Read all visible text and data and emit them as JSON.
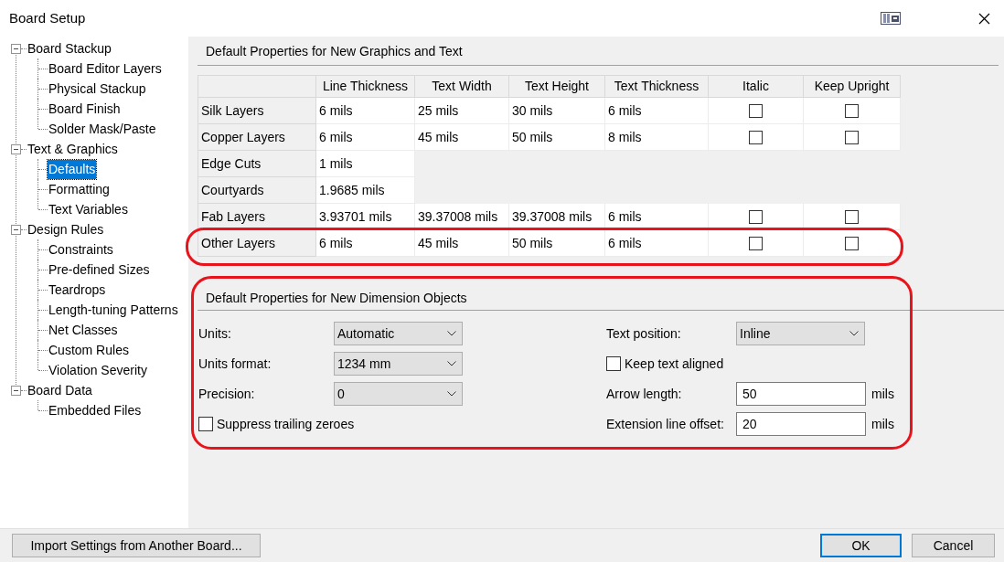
{
  "window": {
    "title": "Board Setup"
  },
  "tree": [
    {
      "label": "Board Stackup",
      "expanded": true,
      "selected": false,
      "children": [
        {
          "label": "Board Editor Layers",
          "selected": false
        },
        {
          "label": "Physical Stackup",
          "selected": false
        },
        {
          "label": "Board Finish",
          "selected": false
        },
        {
          "label": "Solder Mask/Paste",
          "selected": false
        }
      ]
    },
    {
      "label": "Text & Graphics",
      "expanded": true,
      "selected": false,
      "children": [
        {
          "label": "Defaults",
          "selected": true
        },
        {
          "label": "Formatting",
          "selected": false
        },
        {
          "label": "Text Variables",
          "selected": false
        }
      ]
    },
    {
      "label": "Design Rules",
      "expanded": true,
      "selected": false,
      "children": [
        {
          "label": "Constraints",
          "selected": false
        },
        {
          "label": "Pre-defined Sizes",
          "selected": false
        },
        {
          "label": "Teardrops",
          "selected": false
        },
        {
          "label": "Length-tuning Patterns",
          "selected": false
        },
        {
          "label": "Net Classes",
          "selected": false
        },
        {
          "label": "Custom Rules",
          "selected": false
        },
        {
          "label": "Violation Severity",
          "selected": false
        }
      ]
    },
    {
      "label": "Board Data",
      "expanded": true,
      "selected": false,
      "children": [
        {
          "label": "Embedded Files",
          "selected": false
        }
      ]
    }
  ],
  "graphics_defaults": {
    "title": "Default Properties for New Graphics and Text",
    "columns": [
      "Line Thickness",
      "Text Width",
      "Text Height",
      "Text Thickness",
      "Italic",
      "Keep Upright"
    ],
    "rows": [
      {
        "label": "Silk Layers",
        "cells": [
          "6 mils",
          "25 mils",
          "30 mils",
          "6 mils"
        ],
        "italic": false,
        "keep_upright": false,
        "highlighted": false
      },
      {
        "label": "Copper Layers",
        "cells": [
          "6 mils",
          "45 mils",
          "50 mils",
          "8 mils"
        ],
        "italic": false,
        "keep_upright": false,
        "highlighted": false
      },
      {
        "label": "Edge Cuts",
        "cells": [
          "1 mils"
        ],
        "highlighted": false
      },
      {
        "label": "Courtyards",
        "cells": [
          "1.9685 mils"
        ],
        "highlighted": false
      },
      {
        "label": "Fab Layers",
        "cells": [
          "3.93701 mils",
          "39.37008 mils",
          "39.37008 mils",
          "6 mils"
        ],
        "italic": false,
        "keep_upright": false,
        "highlighted": false
      },
      {
        "label": "Other Layers",
        "cells": [
          "6 mils",
          "45 mils",
          "50 mils",
          "6 mils"
        ],
        "italic": false,
        "keep_upright": false,
        "highlighted": true
      }
    ]
  },
  "dimension_defaults": {
    "title": "Default Properties for New Dimension Objects",
    "highlighted": true,
    "left": [
      {
        "kind": "select",
        "label": "Units:",
        "value": "Automatic"
      },
      {
        "kind": "select",
        "label": "Units format:",
        "value": "1234 mm"
      },
      {
        "kind": "select",
        "label": "Precision:",
        "value": "0"
      },
      {
        "kind": "checkbox",
        "label": "Suppress trailing zeroes",
        "checked": false
      }
    ],
    "right": [
      {
        "kind": "select",
        "label": "Text position:",
        "value": "Inline"
      },
      {
        "kind": "checkbox",
        "label": "Keep text aligned",
        "checked": false
      },
      {
        "kind": "number",
        "label": "Arrow length:",
        "value": "50",
        "unit": "mils"
      },
      {
        "kind": "number",
        "label": "Extension line offset:",
        "value": "20",
        "unit": "mils"
      }
    ]
  },
  "buttons": {
    "import": "Import Settings from Another Board...",
    "ok": "OK",
    "cancel": "Cancel"
  }
}
